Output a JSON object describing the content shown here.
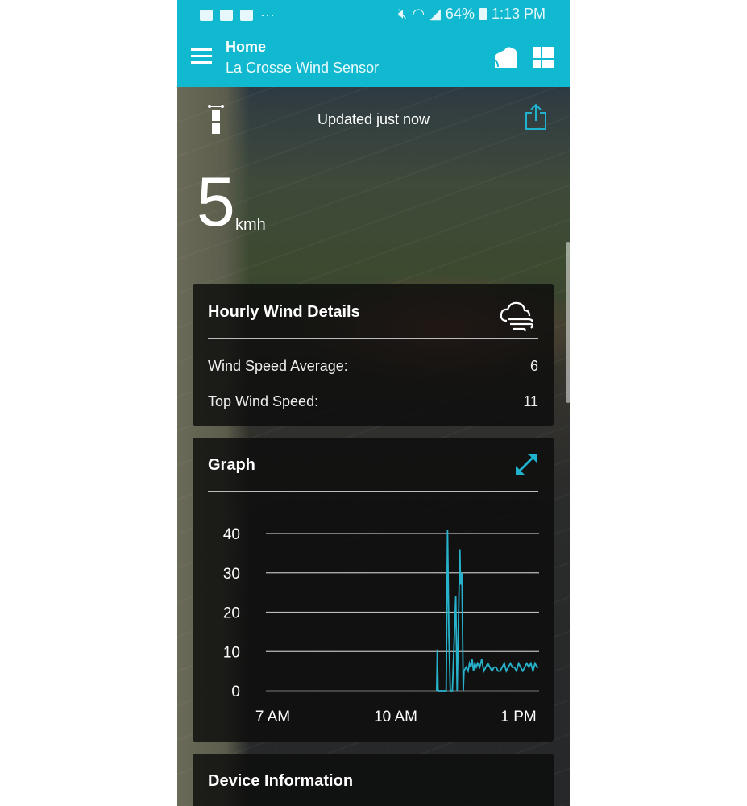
{
  "status_bar": {
    "battery": "64%",
    "time": "1:13 PM",
    "more": "···"
  },
  "app_bar": {
    "title": "Home",
    "subtitle": "La Crosse Wind Sensor"
  },
  "sensor": {
    "updated": "Updated just now",
    "speed": "5",
    "unit": "kmh"
  },
  "hourly": {
    "title": "Hourly Wind Details",
    "rows": [
      {
        "label": "Wind Speed Average:",
        "value": "6"
      },
      {
        "label": "Top Wind Speed:",
        "value": "11"
      }
    ]
  },
  "graph": {
    "title": "Graph"
  },
  "device": {
    "title": "Device Information"
  },
  "colors": {
    "accent": "#10b8d0",
    "line": "#27b3cc"
  },
  "chart_data": {
    "type": "line",
    "ylim": [
      0,
      40
    ],
    "yticks": [
      "0",
      "10",
      "20",
      "30",
      "40"
    ],
    "xticks": [
      "7 AM",
      "10 AM",
      "1 PM"
    ],
    "xlim": [
      "06:50",
      "13:30"
    ],
    "grid": "horizontal",
    "series": [
      {
        "x": [
          "11:00",
          "11:01",
          "11:02",
          "11:14",
          "11:16",
          "11:18",
          "11:20",
          "11:23",
          "11:28",
          "11:30",
          "11:34",
          "11:35",
          "11:37",
          "11:39",
          "11:40",
          "11:43",
          "11:46",
          "11:48",
          "11:50",
          "11:52",
          "11:54",
          "11:56",
          "11:58",
          "12:00",
          "12:03",
          "12:06",
          "12:09",
          "12:12",
          "12:15",
          "12:18",
          "12:21",
          "12:24",
          "12:27",
          "12:30",
          "12:33",
          "12:36",
          "12:39",
          "12:42",
          "12:45",
          "12:48",
          "12:51",
          "12:54",
          "12:57",
          "13:00",
          "13:03",
          "13:06",
          "13:09",
          "13:12",
          "13:15",
          "13:18",
          "13:21",
          "13:24",
          "13:27",
          "13:29"
        ],
        "y": [
          0,
          10.5,
          0,
          0,
          41,
          14,
          0,
          0,
          24,
          0,
          36,
          27,
          30,
          0,
          5,
          6,
          5,
          7,
          6,
          8,
          5,
          7,
          6,
          7,
          6,
          8,
          5,
          6,
          7,
          6,
          5,
          6,
          6,
          5,
          5,
          6,
          7,
          5,
          6,
          7,
          6,
          6,
          5,
          7,
          6,
          5,
          6,
          7,
          6,
          7,
          5,
          7,
          6,
          6
        ]
      }
    ]
  }
}
